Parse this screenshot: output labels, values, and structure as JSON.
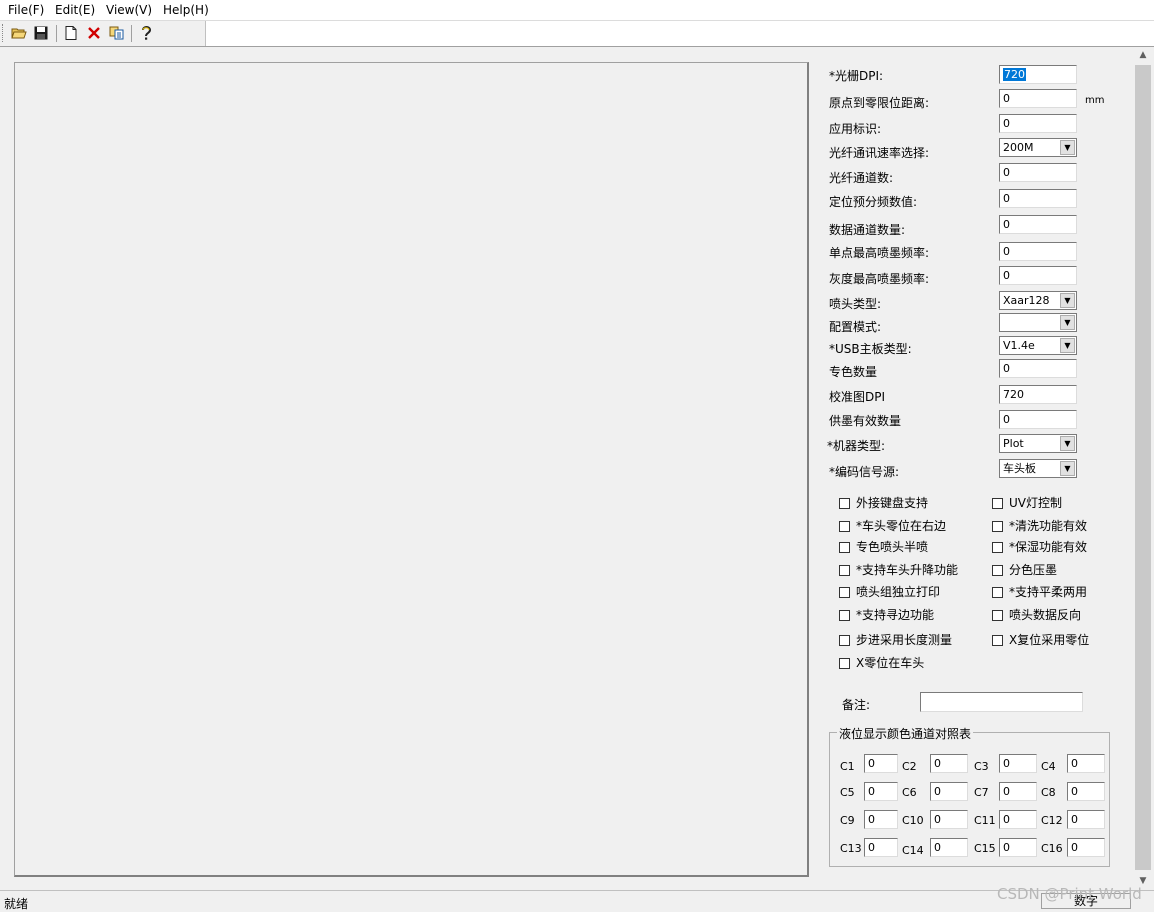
{
  "menu": [
    "File(F)",
    "Edit(E)",
    "View(V)",
    "Help(H)"
  ],
  "toolbar_icons": [
    "open-icon",
    "save-icon",
    "new-icon",
    "delete-icon",
    "copy-icon",
    "help-icon"
  ],
  "form": {
    "dpi": {
      "label": "*光栅DPI:",
      "value": "720"
    },
    "origin_dist": {
      "label": "原点到零限位距离:",
      "value": "0",
      "unit": "mm"
    },
    "app_id": {
      "label": "应用标识:",
      "value": "0"
    },
    "fiber_rate": {
      "label": "光纤通讯速率选择:",
      "value": "200M"
    },
    "fiber_channels": {
      "label": "光纤通道数:",
      "value": "0"
    },
    "prediv": {
      "label": "定位预分频数值:",
      "value": "0"
    },
    "data_channels": {
      "label": "数据通道数量:",
      "value": "0"
    },
    "single_freq": {
      "label": "单点最高喷墨频率:",
      "value": "0"
    },
    "gray_freq": {
      "label": "灰度最高喷墨频率:",
      "value": "0"
    },
    "head_type": {
      "label": "喷头类型:",
      "value": "Xaar128"
    },
    "config_mode": {
      "label": "配置模式:",
      "value": ""
    },
    "usb_board": {
      "label": "*USB主板类型:",
      "value": "V1.4e"
    },
    "spot_count": {
      "label": "专色数量",
      "value": "0"
    },
    "calib_dpi": {
      "label": "校准图DPI",
      "value": "720"
    },
    "ink_supply": {
      "label": "供墨有效数量",
      "value": "0"
    },
    "machine_type": {
      "label": "*机器类型:",
      "value": "Plot"
    },
    "encoder_src": {
      "label": "*编码信号源:",
      "value": "车头板"
    }
  },
  "checkboxes": {
    "left": [
      "外接键盘支持",
      "*车头零位在右边",
      "专色喷头半喷",
      "*支持车头升降功能",
      "喷头组独立打印",
      "*支持寻边功能",
      "步进采用长度测量",
      "X零位在车头"
    ],
    "right": [
      "UV灯控制",
      "*清洗功能有效",
      "*保湿功能有效",
      "分色压墨",
      "*支持平柔两用",
      "喷头数据反向",
      "X复位采用零位"
    ]
  },
  "remark": {
    "label": "备注:",
    "value": ""
  },
  "channel_table": {
    "title": "液位显示颜色通道对照表",
    "channels": [
      {
        "label": "C1",
        "value": "0"
      },
      {
        "label": "C2",
        "value": "0"
      },
      {
        "label": "C3",
        "value": "0"
      },
      {
        "label": "C4",
        "value": "0"
      },
      {
        "label": "C5",
        "value": "0"
      },
      {
        "label": "C6",
        "value": "0"
      },
      {
        "label": "C7",
        "value": "0"
      },
      {
        "label": "C8",
        "value": "0"
      },
      {
        "label": "C9",
        "value": "0"
      },
      {
        "label": "C10",
        "value": "0"
      },
      {
        "label": "C11",
        "value": "0"
      },
      {
        "label": "C12",
        "value": "0"
      },
      {
        "label": "C13",
        "value": "0"
      },
      {
        "label": "C14",
        "value": "0"
      },
      {
        "label": "C15",
        "value": "0"
      },
      {
        "label": "C16",
        "value": "0"
      }
    ]
  },
  "status": {
    "text": "就绪",
    "panel": "数字"
  },
  "watermark": "CSDN @Print World"
}
